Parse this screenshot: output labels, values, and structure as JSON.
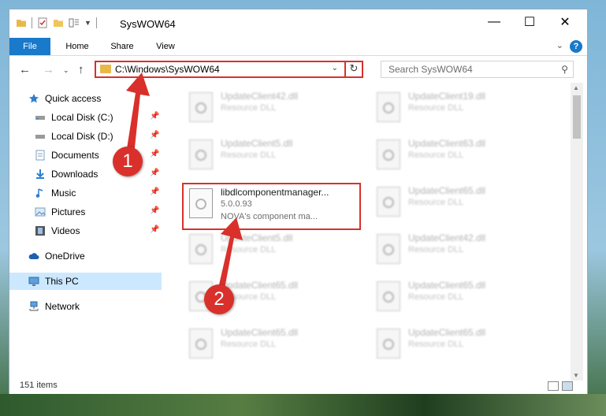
{
  "window": {
    "title": "SysWOW64",
    "controls": {
      "minimize": "—",
      "maximize": "☐",
      "close": "✕"
    }
  },
  "ribbon": {
    "tabs": [
      "File",
      "Home",
      "Share",
      "View"
    ],
    "help": "?",
    "active_tab_color": "#1979ca"
  },
  "address": {
    "path": "C:\\Windows\\SysWOW64",
    "search_placeholder": "Search SysWOW64"
  },
  "nav": {
    "items": [
      {
        "label": "Quick access",
        "icon": "star-icon",
        "pinned": false
      },
      {
        "label": "Local Disk (C:)",
        "icon": "drive-icon",
        "pinned": true
      },
      {
        "label": "Local Disk (D:)",
        "icon": "drive-icon",
        "pinned": true
      },
      {
        "label": "Documents",
        "icon": "documents-icon",
        "pinned": true
      },
      {
        "label": "Downloads",
        "icon": "downloads-icon",
        "pinned": true
      },
      {
        "label": "Music",
        "icon": "music-icon",
        "pinned": true
      },
      {
        "label": "Pictures",
        "icon": "pictures-icon",
        "pinned": true
      },
      {
        "label": "Videos",
        "icon": "videos-icon",
        "pinned": true
      },
      {
        "label": "OneDrive",
        "icon": "cloud-icon",
        "pinned": false
      },
      {
        "label": "This PC",
        "icon": "computer-icon",
        "pinned": false,
        "selected": true
      },
      {
        "label": "Network",
        "icon": "network-icon",
        "pinned": false
      }
    ]
  },
  "files": {
    "highlighted": {
      "name": "libdlcomponentmanager...",
      "version": "5.0.0.93",
      "description": "NOVA's component ma..."
    },
    "left_column": [
      {
        "name": "UpdateClient42.dll",
        "type": "Resource DLL"
      },
      {
        "name": "UpdateClient5.dll",
        "type": "Resource DLL"
      },
      null,
      {
        "name": "UpdateClient5.dll",
        "type": "Resource DLL"
      },
      {
        "name": "UpdateClient65.dll",
        "type": "Resource DLL"
      },
      {
        "name": "UpdateClient65.dll",
        "type": "Resource DLL"
      }
    ],
    "right_column": [
      {
        "name": "UpdateClient19.dll",
        "type": "Resource DLL"
      },
      {
        "name": "UpdateClient63.dll",
        "type": "Resource DLL"
      },
      {
        "name": "UpdateClient65.dll",
        "type": "Resource DLL"
      },
      {
        "name": "UpdateClient42.dll",
        "type": "Resource DLL"
      },
      {
        "name": "UpdateClient65.dll",
        "type": "Resource DLL"
      },
      {
        "name": "UpdateClient65.dll",
        "type": "Resource DLL"
      }
    ]
  },
  "status": {
    "item_count": "151 items"
  },
  "annotations": {
    "marker1": "1",
    "marker2": "2",
    "color": "#d9302b"
  }
}
